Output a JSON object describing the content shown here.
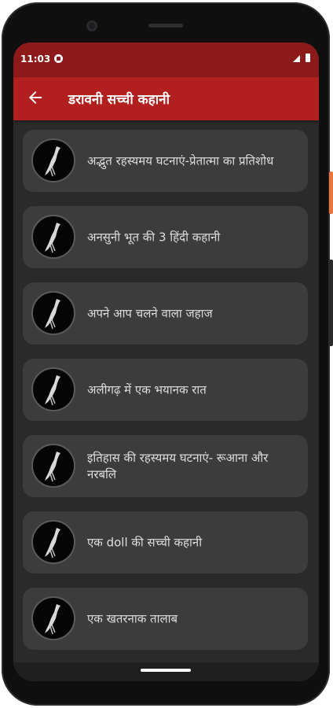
{
  "status_bar": {
    "time": "11:03"
  },
  "app_bar": {
    "title": "डरावनी सच्ची कहानी"
  },
  "stories": [
    {
      "title": "अद्भुत रहस्यमय घटनाएं-प्रेतात्मा का प्रतिशोध"
    },
    {
      "title": "अनसुनी भूत की 3 हिंदी कहानी"
    },
    {
      "title": "अपने आप चलने वाला जहाज"
    },
    {
      "title": "अलीगढ़ में एक भयानक रात"
    },
    {
      "title": "इतिहास की रहस्यमय घटनाएं- रूआना और नरबलि"
    },
    {
      "title": "एक doll की सच्ची कहानी"
    },
    {
      "title": "एक खतरनाक तालाब"
    }
  ],
  "icons": {
    "back": "arrow-left-icon",
    "story_thumb": "bird-icon"
  }
}
